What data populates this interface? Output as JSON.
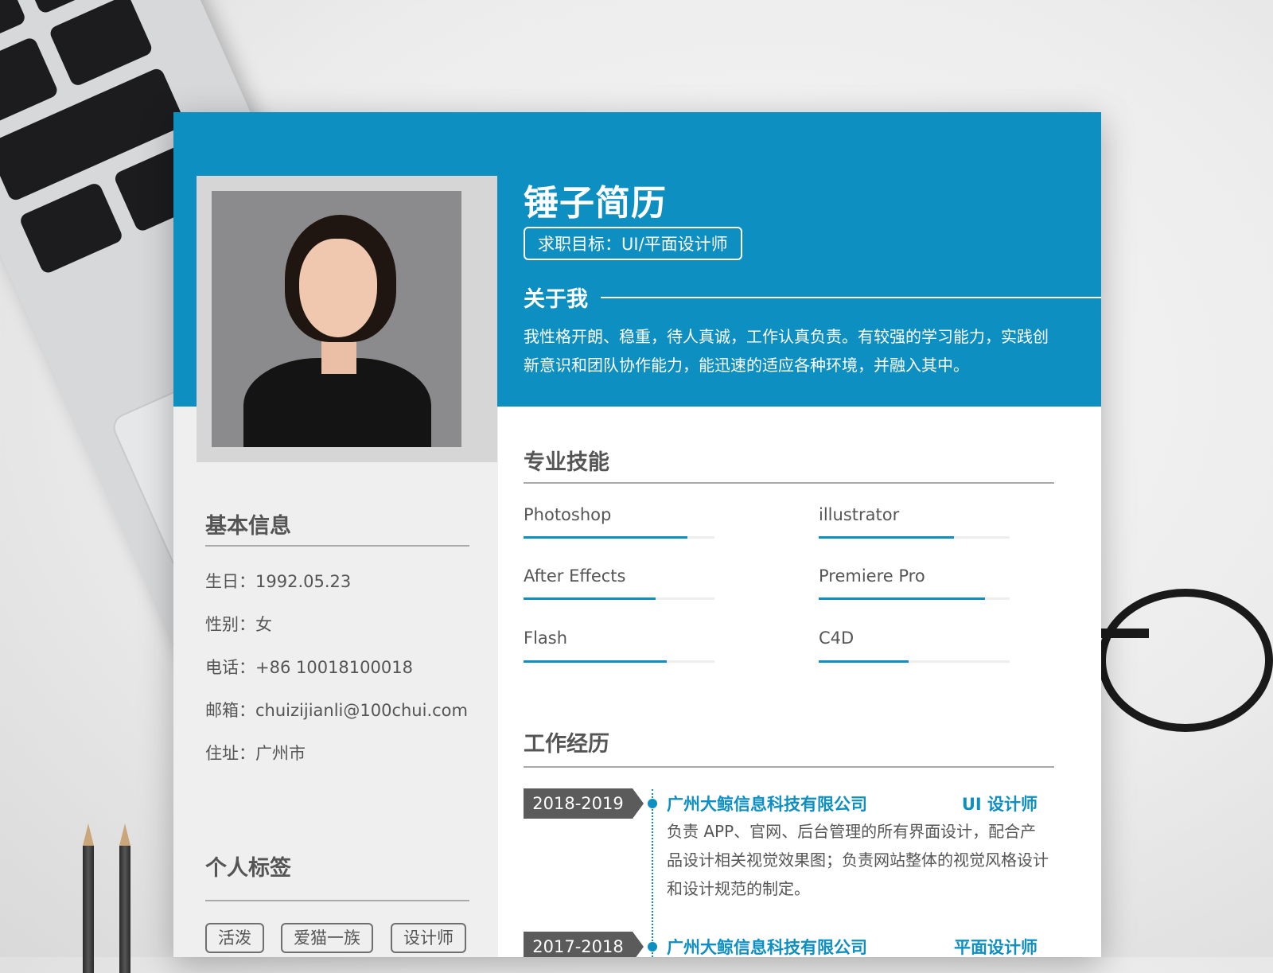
{
  "header": {
    "name": "锤子简历",
    "objective": "求职目标：UI/平面设计师"
  },
  "about": {
    "title": "关于我",
    "text": "我性格开朗、稳重，待人真诚，工作认真负责。有较强的学习能力，实践创新意识和团队协作能力，能迅速的适应各种环境，并融入其中。"
  },
  "basic_info": {
    "title": "基本信息",
    "rows": [
      "生日：1992.05.23",
      "性别：女",
      "电话：+86 10018100018",
      "邮箱：chuizijianli@100chui.com",
      "住址：广州市"
    ]
  },
  "tags": {
    "title": "个人标签",
    "items": [
      "活泼",
      "爱猫一族",
      "设计师"
    ]
  },
  "skills": {
    "title": "专业技能",
    "items": [
      {
        "name": "Photoshop",
        "level": 0.86
      },
      {
        "name": "illustrator",
        "level": 0.71
      },
      {
        "name": "After Effects",
        "level": 0.69
      },
      {
        "name": "Premiere Pro",
        "level": 0.87
      },
      {
        "name": "Flash",
        "level": 0.75
      },
      {
        "name": "C4D",
        "level": 0.47
      }
    ]
  },
  "work": {
    "title": "工作经历",
    "items": [
      {
        "years": "2018-2019",
        "company": "广州大鲸信息科技有限公司",
        "role": "UI 设计师",
        "desc": "负责 APP、官网、后台管理的所有界面设计，配合产品设计相关视觉效果图；负责网站整体的视觉风格设计和设计规范的制定。"
      },
      {
        "years": "2017-2018",
        "company": "广州大鲸信息科技有限公司",
        "role": "平面设计师"
      }
    ]
  }
}
